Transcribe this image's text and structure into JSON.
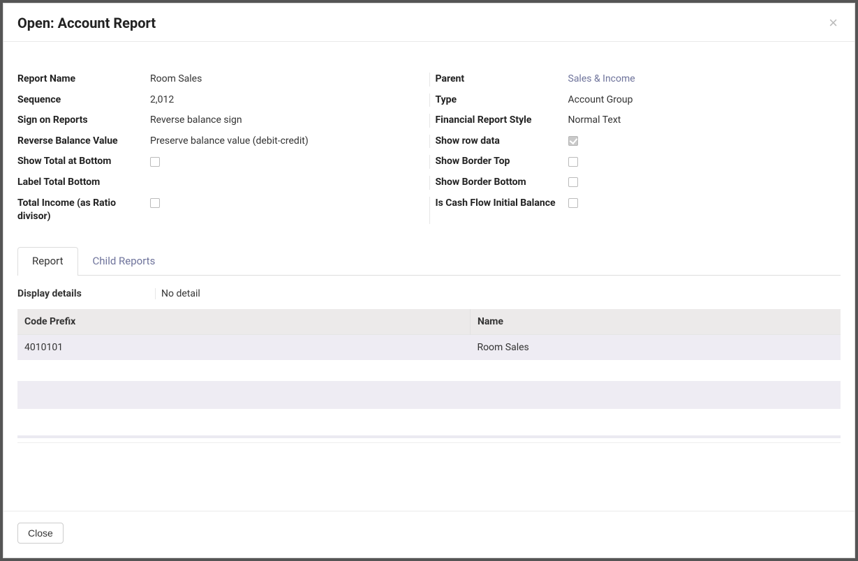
{
  "dialog": {
    "title": "Open: Account Report",
    "close_button_label": "Close"
  },
  "fields": {
    "left": {
      "report_name": {
        "label": "Report Name",
        "value": "Room Sales"
      },
      "sequence": {
        "label": "Sequence",
        "value": "2,012"
      },
      "sign": {
        "label": "Sign on Reports",
        "value": "Reverse balance sign"
      },
      "reverse": {
        "label": "Reverse Balance Value",
        "value": "Preserve balance value (debit-credit)"
      },
      "show_total": {
        "label": "Show Total at Bottom",
        "checked": false
      },
      "label_total": {
        "label": "Label Total Bottom"
      },
      "total_income": {
        "label": "Total Income (as Ratio divisor)",
        "checked": false
      }
    },
    "right": {
      "parent": {
        "label": "Parent",
        "value": "Sales & Income"
      },
      "type": {
        "label": "Type",
        "value": "Account Group"
      },
      "style": {
        "label": "Financial Report Style",
        "value": "Normal Text"
      },
      "show_row": {
        "label": "Show row data",
        "checked": true
      },
      "border_top": {
        "label": "Show Border Top",
        "checked": false
      },
      "border_bot": {
        "label": "Show Border Bottom",
        "checked": false
      },
      "cash_flow": {
        "label": "Is Cash Flow Initial Balance",
        "checked": false
      }
    }
  },
  "tabs": {
    "report": "Report",
    "child": "Child Reports"
  },
  "report_tab": {
    "display_details": {
      "label": "Display details",
      "value": "No detail"
    },
    "table": {
      "headers": {
        "code": "Code Prefix",
        "name": "Name"
      },
      "rows": [
        {
          "code": "4010101",
          "name": "Room Sales"
        }
      ]
    }
  }
}
